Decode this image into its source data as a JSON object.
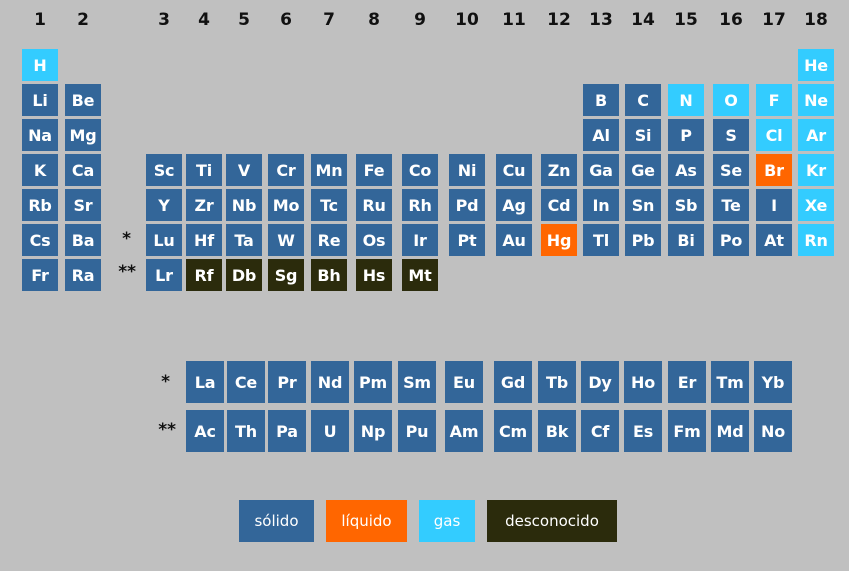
{
  "colors": {
    "background": "#c0c0c0",
    "solid": "#336699",
    "liquid": "#ff6600",
    "gas": "#33ccff",
    "unknown": "#2b2b0c"
  },
  "groups": [
    "1",
    "2",
    "3",
    "4",
    "5",
    "6",
    "7",
    "8",
    "9",
    "10",
    "11",
    "12",
    "13",
    "14",
    "15",
    "16",
    "17",
    "18"
  ],
  "main_table": [
    {
      "symbol": "H",
      "row": 1,
      "group": 1,
      "state": "gas"
    },
    {
      "symbol": "He",
      "row": 1,
      "group": 18,
      "state": "gas"
    },
    {
      "symbol": "Li",
      "row": 2,
      "group": 1,
      "state": "solid"
    },
    {
      "symbol": "Be",
      "row": 2,
      "group": 2,
      "state": "solid"
    },
    {
      "symbol": "B",
      "row": 2,
      "group": 13,
      "state": "solid"
    },
    {
      "symbol": "C",
      "row": 2,
      "group": 14,
      "state": "solid"
    },
    {
      "symbol": "N",
      "row": 2,
      "group": 15,
      "state": "gas"
    },
    {
      "symbol": "O",
      "row": 2,
      "group": 16,
      "state": "gas"
    },
    {
      "symbol": "F",
      "row": 2,
      "group": 17,
      "state": "gas"
    },
    {
      "symbol": "Ne",
      "row": 2,
      "group": 18,
      "state": "gas"
    },
    {
      "symbol": "Na",
      "row": 3,
      "group": 1,
      "state": "solid"
    },
    {
      "symbol": "Mg",
      "row": 3,
      "group": 2,
      "state": "solid"
    },
    {
      "symbol": "Al",
      "row": 3,
      "group": 13,
      "state": "solid"
    },
    {
      "symbol": "Si",
      "row": 3,
      "group": 14,
      "state": "solid"
    },
    {
      "symbol": "P",
      "row": 3,
      "group": 15,
      "state": "solid"
    },
    {
      "symbol": "S",
      "row": 3,
      "group": 16,
      "state": "solid"
    },
    {
      "symbol": "Cl",
      "row": 3,
      "group": 17,
      "state": "gas"
    },
    {
      "symbol": "Ar",
      "row": 3,
      "group": 18,
      "state": "gas"
    },
    {
      "symbol": "K",
      "row": 4,
      "group": 1,
      "state": "solid"
    },
    {
      "symbol": "Ca",
      "row": 4,
      "group": 2,
      "state": "solid"
    },
    {
      "symbol": "Sc",
      "row": 4,
      "group": 3,
      "state": "solid"
    },
    {
      "symbol": "Ti",
      "row": 4,
      "group": 4,
      "state": "solid"
    },
    {
      "symbol": "V",
      "row": 4,
      "group": 5,
      "state": "solid"
    },
    {
      "symbol": "Cr",
      "row": 4,
      "group": 6,
      "state": "solid"
    },
    {
      "symbol": "Mn",
      "row": 4,
      "group": 7,
      "state": "solid"
    },
    {
      "symbol": "Fe",
      "row": 4,
      "group": 8,
      "state": "solid"
    },
    {
      "symbol": "Co",
      "row": 4,
      "group": 9,
      "state": "solid"
    },
    {
      "symbol": "Ni",
      "row": 4,
      "group": 10,
      "state": "solid"
    },
    {
      "symbol": "Cu",
      "row": 4,
      "group": 11,
      "state": "solid"
    },
    {
      "symbol": "Zn",
      "row": 4,
      "group": 12,
      "state": "solid"
    },
    {
      "symbol": "Ga",
      "row": 4,
      "group": 13,
      "state": "solid"
    },
    {
      "symbol": "Ge",
      "row": 4,
      "group": 14,
      "state": "solid"
    },
    {
      "symbol": "As",
      "row": 4,
      "group": 15,
      "state": "solid"
    },
    {
      "symbol": "Se",
      "row": 4,
      "group": 16,
      "state": "solid"
    },
    {
      "symbol": "Br",
      "row": 4,
      "group": 17,
      "state": "liquid"
    },
    {
      "symbol": "Kr",
      "row": 4,
      "group": 18,
      "state": "gas"
    },
    {
      "symbol": "Rb",
      "row": 5,
      "group": 1,
      "state": "solid"
    },
    {
      "symbol": "Sr",
      "row": 5,
      "group": 2,
      "state": "solid"
    },
    {
      "symbol": "Y",
      "row": 5,
      "group": 3,
      "state": "solid"
    },
    {
      "symbol": "Zr",
      "row": 5,
      "group": 4,
      "state": "solid"
    },
    {
      "symbol": "Nb",
      "row": 5,
      "group": 5,
      "state": "solid"
    },
    {
      "symbol": "Mo",
      "row": 5,
      "group": 6,
      "state": "solid"
    },
    {
      "symbol": "Tc",
      "row": 5,
      "group": 7,
      "state": "solid"
    },
    {
      "symbol": "Ru",
      "row": 5,
      "group": 8,
      "state": "solid"
    },
    {
      "symbol": "Rh",
      "row": 5,
      "group": 9,
      "state": "solid"
    },
    {
      "symbol": "Pd",
      "row": 5,
      "group": 10,
      "state": "solid"
    },
    {
      "symbol": "Ag",
      "row": 5,
      "group": 11,
      "state": "solid"
    },
    {
      "symbol": "Cd",
      "row": 5,
      "group": 12,
      "state": "solid"
    },
    {
      "symbol": "In",
      "row": 5,
      "group": 13,
      "state": "solid"
    },
    {
      "symbol": "Sn",
      "row": 5,
      "group": 14,
      "state": "solid"
    },
    {
      "symbol": "Sb",
      "row": 5,
      "group": 15,
      "state": "solid"
    },
    {
      "symbol": "Te",
      "row": 5,
      "group": 16,
      "state": "solid"
    },
    {
      "symbol": "I",
      "row": 5,
      "group": 17,
      "state": "solid"
    },
    {
      "symbol": "Xe",
      "row": 5,
      "group": 18,
      "state": "gas"
    },
    {
      "symbol": "Cs",
      "row": 6,
      "group": 1,
      "state": "solid"
    },
    {
      "symbol": "Ba",
      "row": 6,
      "group": 2,
      "state": "solid"
    },
    {
      "symbol": "Lu",
      "row": 6,
      "group": 3,
      "state": "solid"
    },
    {
      "symbol": "Hf",
      "row": 6,
      "group": 4,
      "state": "solid"
    },
    {
      "symbol": "Ta",
      "row": 6,
      "group": 5,
      "state": "solid"
    },
    {
      "symbol": "W",
      "row": 6,
      "group": 6,
      "state": "solid"
    },
    {
      "symbol": "Re",
      "row": 6,
      "group": 7,
      "state": "solid"
    },
    {
      "symbol": "Os",
      "row": 6,
      "group": 8,
      "state": "solid"
    },
    {
      "symbol": "Ir",
      "row": 6,
      "group": 9,
      "state": "solid"
    },
    {
      "symbol": "Pt",
      "row": 6,
      "group": 10,
      "state": "solid"
    },
    {
      "symbol": "Au",
      "row": 6,
      "group": 11,
      "state": "solid"
    },
    {
      "symbol": "Hg",
      "row": 6,
      "group": 12,
      "state": "liquid"
    },
    {
      "symbol": "Tl",
      "row": 6,
      "group": 13,
      "state": "solid"
    },
    {
      "symbol": "Pb",
      "row": 6,
      "group": 14,
      "state": "solid"
    },
    {
      "symbol": "Bi",
      "row": 6,
      "group": 15,
      "state": "solid"
    },
    {
      "symbol": "Po",
      "row": 6,
      "group": 16,
      "state": "solid"
    },
    {
      "symbol": "At",
      "row": 6,
      "group": 17,
      "state": "solid"
    },
    {
      "symbol": "Rn",
      "row": 6,
      "group": 18,
      "state": "gas"
    },
    {
      "symbol": "Fr",
      "row": 7,
      "group": 1,
      "state": "solid"
    },
    {
      "symbol": "Ra",
      "row": 7,
      "group": 2,
      "state": "solid"
    },
    {
      "symbol": "Lr",
      "row": 7,
      "group": 3,
      "state": "solid"
    },
    {
      "symbol": "Rf",
      "row": 7,
      "group": 4,
      "state": "unknown"
    },
    {
      "symbol": "Db",
      "row": 7,
      "group": 5,
      "state": "unknown"
    },
    {
      "symbol": "Sg",
      "row": 7,
      "group": 6,
      "state": "unknown"
    },
    {
      "symbol": "Bh",
      "row": 7,
      "group": 7,
      "state": "unknown"
    },
    {
      "symbol": "Hs",
      "row": 7,
      "group": 8,
      "state": "unknown"
    },
    {
      "symbol": "Mt",
      "row": 7,
      "group": 9,
      "state": "unknown"
    }
  ],
  "markers": {
    "period6": "*",
    "period7": "**",
    "lanthanides": "*",
    "actinides": "**"
  },
  "lanthanides": [
    "La",
    "Ce",
    "Pr",
    "Nd",
    "Pm",
    "Sm",
    "Eu",
    "Gd",
    "Tb",
    "Dy",
    "Ho",
    "Er",
    "Tm",
    "Yb"
  ],
  "actinides": [
    "Ac",
    "Th",
    "Pa",
    "U",
    "Np",
    "Pu",
    "Am",
    "Cm",
    "Bk",
    "Cf",
    "Es",
    "Fm",
    "Md",
    "No"
  ],
  "legend": [
    {
      "label": "sólido",
      "state": "solid"
    },
    {
      "label": "líquido",
      "state": "liquid"
    },
    {
      "label": "gas",
      "state": "gas"
    },
    {
      "label": "desconocido",
      "state": "unknown"
    }
  ]
}
